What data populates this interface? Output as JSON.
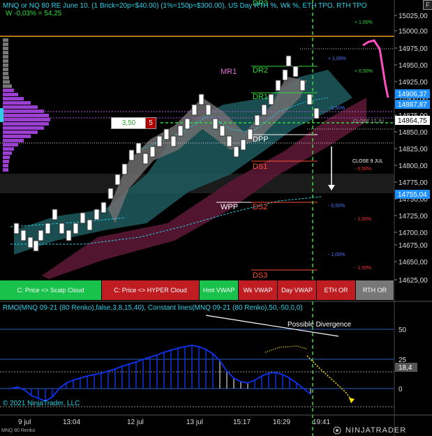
{
  "header": {
    "line1": "MNQ or NQ 80 RE June 10. (1 Brick=20p=$40.00) (1%=150p=$300.00), US Day RTH %, Wk %, ETH TPO, RTH TPO",
    "line2": "W -0,03% = 54,25"
  },
  "window_button": "F",
  "price_axis": {
    "labels": [
      "15025,00",
      "15000,00",
      "14975,00",
      "14950,00",
      "14925,00",
      "14900,00",
      "14875,00",
      "14850,00",
      "14825,00",
      "14800,00",
      "14775,00",
      "14750,00",
      "14725,00",
      "14700,00",
      "14675,00",
      "14650,00",
      "14625,00"
    ],
    "tags": [
      {
        "text": "14906,37",
        "color": "#1e90ff",
        "fg": "#fff"
      },
      {
        "text": "14887,87",
        "color": "#1e90ff",
        "fg": "#fff"
      },
      {
        "text": "14864,75",
        "color": "#ffffff",
        "fg": "#000"
      },
      {
        "text": "14755,04",
        "color": "#1e90ff",
        "fg": "#fff"
      }
    ]
  },
  "levels": [
    {
      "label": "DR3",
      "color": "#2fdc3a"
    },
    {
      "label": "MR1",
      "color": "#e36fd7"
    },
    {
      "label": "DR2",
      "color": "#2fdc3a"
    },
    {
      "label": "DR1",
      "color": "#2fdc3a"
    },
    {
      "label": "DPP",
      "color": "#ffffff"
    },
    {
      "label": "DS1",
      "color": "#ff5030"
    },
    {
      "label": "WPP",
      "color": "#ffffff"
    },
    {
      "label": "DS2",
      "color": "#ff5030"
    },
    {
      "label": "DS3",
      "color": "#ff5030"
    }
  ],
  "pct_labels": [
    {
      "text": "+ 1,00%",
      "color": "#2fdc3a"
    },
    {
      "text": "+ 1,00%",
      "color": "#4a7bff"
    },
    {
      "text": "+ 0,50%",
      "color": "#2fdc3a"
    },
    {
      "text": "- 0,50%",
      "color": "#4a7bff"
    },
    {
      "text": "CLOSE 12 JU",
      "color": "#aaaaaa"
    },
    {
      "text": "CLOSE 9 JUL",
      "color": "#ffffff"
    },
    {
      "text": "- 0,50%",
      "color": "#ff3030"
    },
    {
      "text": "- 0,50%",
      "color": "#4a7bff"
    },
    {
      "text": "- 1,00%",
      "color": "#ff3030"
    },
    {
      "text": "- 1,00%",
      "color": "#4a7bff"
    },
    {
      "text": "- 1,50%",
      "color": "#ff3030"
    }
  ],
  "trade_box": {
    "value": "3,50",
    "qty": "5"
  },
  "buttons": [
    {
      "label": "C: Price <> Scalp Cloud",
      "bg": "#19c24a"
    },
    {
      "label": "C: Price <> HYPER Cloud",
      "bg": "#c01d22"
    },
    {
      "label": "Hmt VWAP",
      "bg": "#19c24a"
    },
    {
      "label": "Wk VWAP",
      "bg": "#c01d22"
    },
    {
      "label": "Day VWAP",
      "bg": "#c01d22"
    },
    {
      "label": "ETH OR",
      "bg": "#c01d22"
    },
    {
      "label": "RTH OR",
      "bg": "#777777"
    }
  ],
  "rmo": {
    "title": "RMO(MNQ 09-21 (80 Renko),false,3,8,15,40), Constant lines(MNQ 09-21 (80 Renko),50,-50,0,0)",
    "annotation": "Possible Divergence",
    "axis": [
      "50",
      "25",
      "0"
    ],
    "current_value": "18,4"
  },
  "time_axis": [
    "9 jul",
    "13:04",
    "12 jul",
    "13 jul",
    "15:17",
    "16:29",
    "19:41"
  ],
  "copyright": "© 2021 NinjaTrader, LLC",
  "brand": "NINJATRADER",
  "instrument": "MNQ 80 Renko"
}
